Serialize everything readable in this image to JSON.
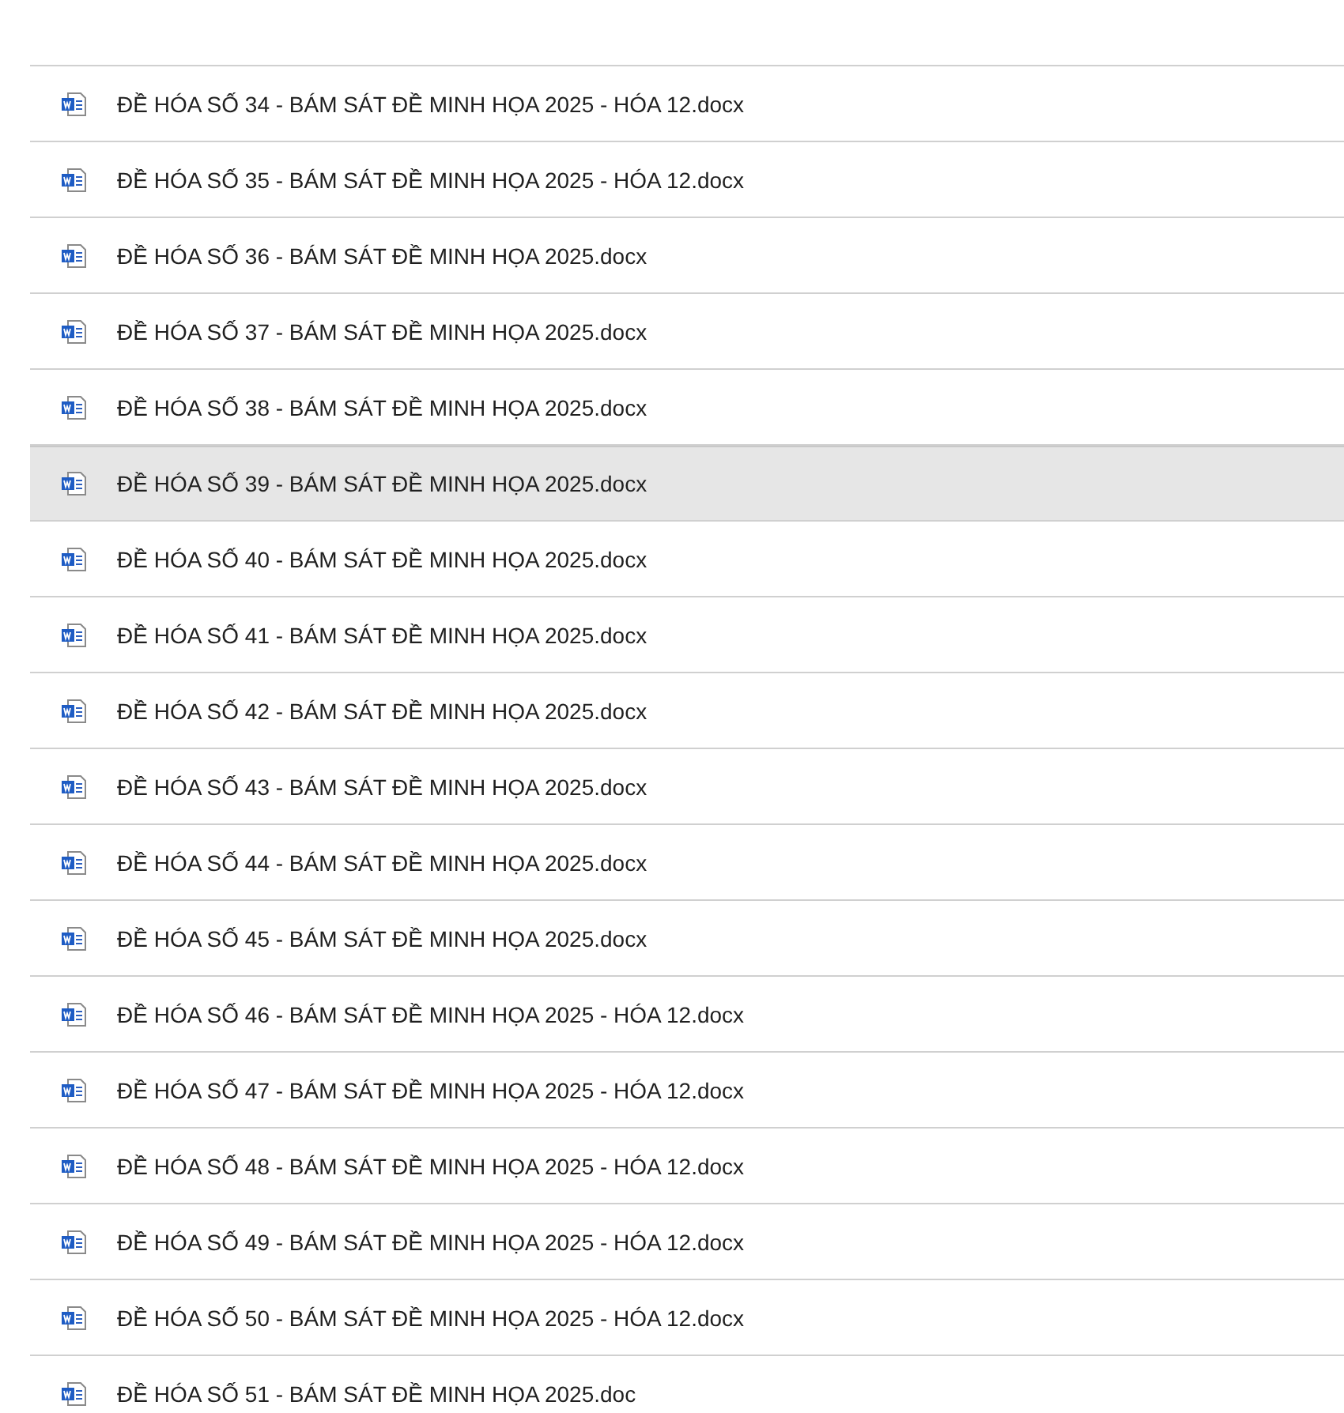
{
  "files": [
    {
      "name": "ĐỀ HÓA SỐ 34 - BÁM SÁT ĐỀ MINH HỌA 2025 - HÓA 12.docx",
      "selected": false
    },
    {
      "name": "ĐỀ HÓA SỐ 35 - BÁM SÁT ĐỀ MINH HỌA 2025 - HÓA 12.docx",
      "selected": false
    },
    {
      "name": "ĐỀ HÓA SỐ 36 - BÁM SÁT ĐỀ MINH HỌA 2025.docx",
      "selected": false
    },
    {
      "name": "ĐỀ HÓA SỐ 37 - BÁM SÁT ĐỀ MINH HỌA 2025.docx",
      "selected": false
    },
    {
      "name": "ĐỀ HÓA SỐ 38 - BÁM SÁT ĐỀ MINH HỌA 2025.docx",
      "selected": false
    },
    {
      "name": "ĐỀ HÓA SỐ 39 - BÁM SÁT ĐỀ MINH HỌA 2025.docx",
      "selected": true
    },
    {
      "name": "ĐỀ HÓA SỐ 40 - BÁM SÁT ĐỀ MINH HỌA 2025.docx",
      "selected": false
    },
    {
      "name": "ĐỀ HÓA SỐ 41 - BÁM SÁT ĐỀ MINH HỌA 2025.docx",
      "selected": false
    },
    {
      "name": "ĐỀ HÓA SỐ 42 - BÁM SÁT ĐỀ MINH HỌA 2025.docx",
      "selected": false
    },
    {
      "name": "ĐỀ HÓA SỐ 43 - BÁM SÁT ĐỀ MINH HỌA 2025.docx",
      "selected": false
    },
    {
      "name": "ĐỀ HÓA SỐ 44 - BÁM SÁT ĐỀ MINH HỌA 2025.docx",
      "selected": false
    },
    {
      "name": "ĐỀ HÓA SỐ 45 - BÁM SÁT ĐỀ MINH HỌA 2025.docx",
      "selected": false
    },
    {
      "name": "ĐỀ HÓA SỐ 46 - BÁM SÁT ĐỀ MINH HỌA 2025 - HÓA 12.docx",
      "selected": false
    },
    {
      "name": "ĐỀ HÓA SỐ 47 - BÁM SÁT ĐỀ MINH HỌA 2025 - HÓA 12.docx",
      "selected": false
    },
    {
      "name": "ĐỀ HÓA SỐ 48 - BÁM SÁT ĐỀ MINH HỌA 2025 - HÓA 12.docx",
      "selected": false
    },
    {
      "name": "ĐỀ HÓA SỐ 49 - BÁM SÁT ĐỀ MINH HỌA 2025 - HÓA 12.docx",
      "selected": false
    },
    {
      "name": "ĐỀ HÓA SỐ 50 - BÁM SÁT ĐỀ MINH HỌA 2025 - HÓA 12.docx",
      "selected": false
    },
    {
      "name": "ĐỀ HÓA SỐ 51 - BÁM SÁT ĐỀ MINH HỌA 2025.doc",
      "selected": false
    }
  ]
}
